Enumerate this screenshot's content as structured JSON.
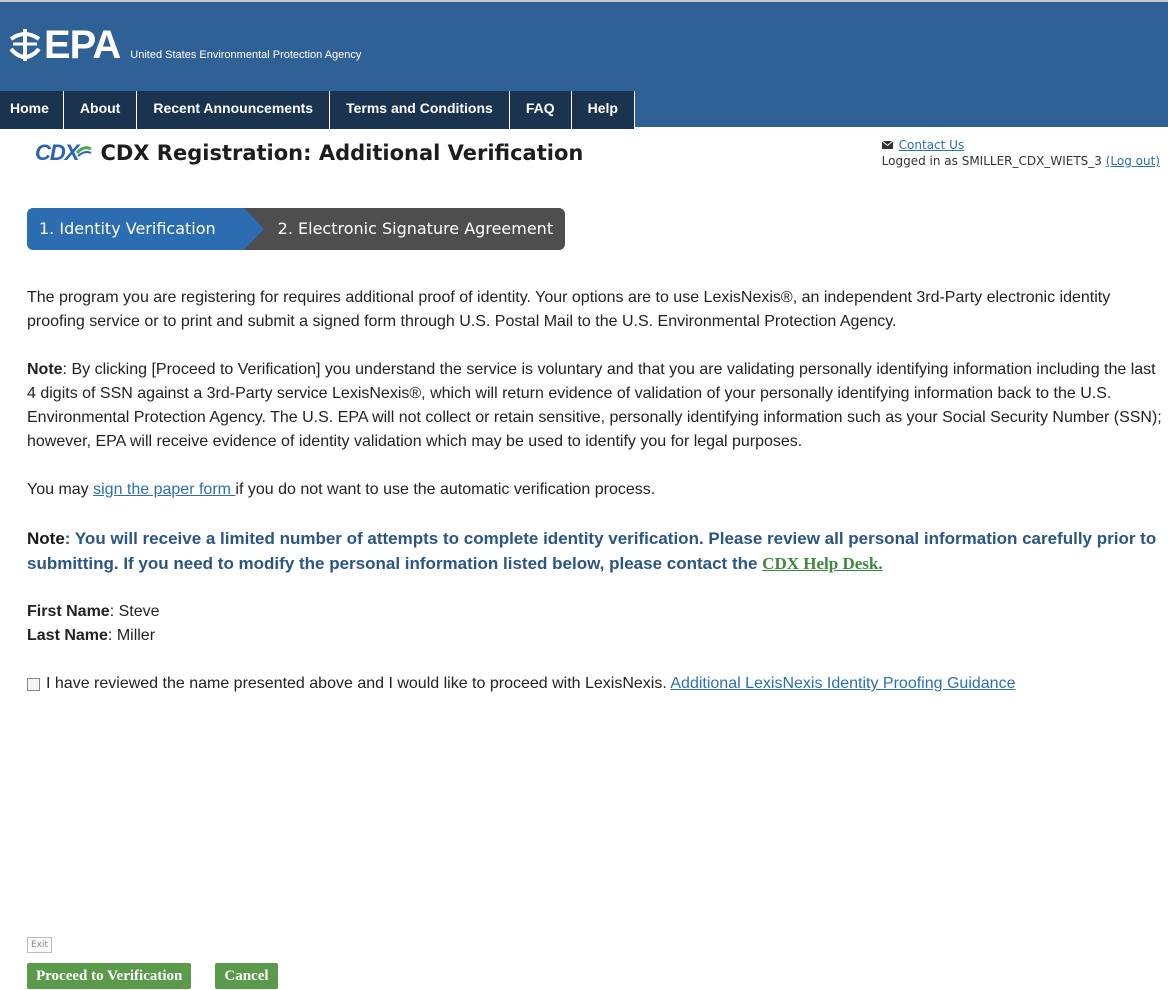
{
  "header": {
    "logo_text": "EPA",
    "agency_name": "United States Environmental Protection Agency",
    "nav": [
      "Home",
      "About",
      "Recent Announcements",
      "Terms and Conditions",
      "FAQ",
      "Help"
    ]
  },
  "title": {
    "cdx_logo": "CDX",
    "text": "CDX Registration: Additional Verification"
  },
  "user_bar": {
    "contact_label": "Contact Us",
    "logged_in_prefix": "Logged in as SMILLER_CDX_WIETS_3",
    "logout_label": "(Log out)"
  },
  "steps": {
    "step1": "1. Identity Verification",
    "step2": "2. Electronic Signature Agreement"
  },
  "content": {
    "para1": "The program you are registering for requires additional proof of identity. Your options are to use LexisNexis®, an independent 3rd-Party electronic identity proofing service or to print and submit a signed form through U.S. Postal Mail to the U.S. Environmental Protection Agency.",
    "note1_label": "Note",
    "note1_text": ": By clicking [Proceed to Verification] you understand the service is voluntary and that you are validating personally identifying information including the last 4 digits of SSN against a 3rd-Party service LexisNexis®, which will return evidence of validation of your personally identifying information back to the U.S. Environmental Protection Agency. The U.S. EPA will not collect or retain sensitive, personally identifying information such as your Social Security Number (SSN); however, EPA will receive evidence of identity validation which may be used to identify you for legal purposes.",
    "paper_prefix": "You may ",
    "paper_link": "sign the paper form ",
    "paper_suffix": " if you do not want to use the automatic verification process.",
    "note2_label": "Note",
    "note2_text": ": You will receive a limited number of attempts to complete identity verification. Please review all personal information carefully prior to submitting. If you need to modify the personal information listed below, please contact the ",
    "help_desk_link": "CDX Help Desk.",
    "first_name_label": "First Name",
    "first_name_value": ": Steve",
    "last_name_label": "Last Name",
    "last_name_value": ": Miller",
    "checkbox_label": "I have reviewed the name presented above and I would like to proceed with LexisNexis. ",
    "guidance_link": "Additional LexisNexis Identity Proofing Guidance"
  },
  "actions": {
    "exit_label": "Exit",
    "proceed_label": "Proceed to Verification",
    "cancel_label": "Cancel"
  }
}
